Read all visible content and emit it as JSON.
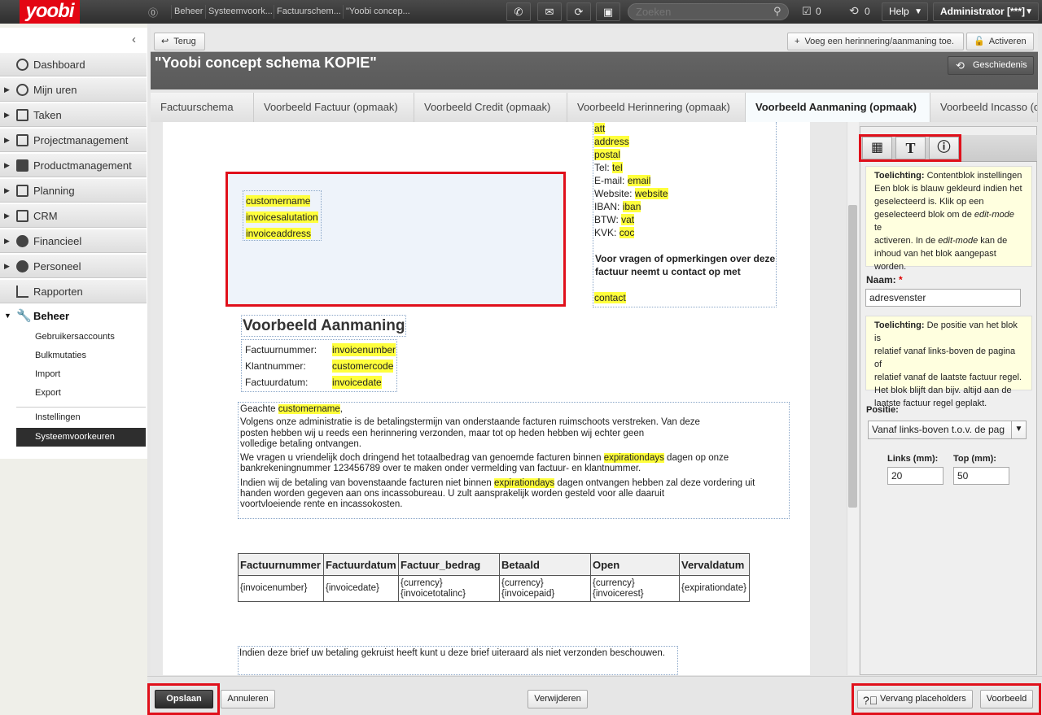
{
  "app": {
    "logo": "yoobi"
  },
  "breadcrumbs": [
    "Beheer",
    "Systeemvoork...",
    "Factuurschem...",
    "\"Yoobi concep..."
  ],
  "topbar": {
    "search_placeholder": "Zoeken",
    "tasks_count": "0",
    "sync_count": "0",
    "help_label": "Help",
    "user_label": "Administrator [***]"
  },
  "sidebar": {
    "items": [
      {
        "label": "Dashboard"
      },
      {
        "label": "Mijn uren"
      },
      {
        "label": "Taken"
      },
      {
        "label": "Projectmanagement"
      },
      {
        "label": "Productmanagement"
      },
      {
        "label": "Planning"
      },
      {
        "label": "CRM"
      },
      {
        "label": "Financieel"
      },
      {
        "label": "Personeel"
      },
      {
        "label": "Rapporten"
      },
      {
        "label": "Beheer"
      }
    ],
    "sub_items": [
      "Gebruikersaccounts",
      "Bulkmutaties",
      "Import",
      "Export",
      "Instellingen",
      "Systeemvoorkeuren"
    ]
  },
  "header": {
    "back_label": "Terug",
    "reminder_label": "Voeg een herinnering/aanmaning toe.",
    "activate_label": "Activeren",
    "title": "\"Yoobi concept schema KOPIE\"",
    "history_label": "Geschiedenis"
  },
  "tabs": [
    {
      "label": "Factuurschema"
    },
    {
      "label": "Voorbeeld Factuur (opmaak)"
    },
    {
      "label": "Voorbeeld Credit (opmaak)"
    },
    {
      "label": "Voorbeeld Herinnering (opmaak)"
    },
    {
      "label": "Voorbeeld Aanmaning (opmaak)"
    },
    {
      "label": "Voorbeeld Incasso (op"
    }
  ],
  "document": {
    "address_fields": [
      "customername",
      "invoicesalutation",
      "invoiceaddress"
    ],
    "company_info": {
      "att": "att",
      "address": "address",
      "postal": "postal",
      "tel_label": "Tel:",
      "tel": "tel",
      "email_label": "E-mail:",
      "email": "email",
      "website_label": "Website:",
      "website": "website",
      "iban_label": "IBAN:",
      "iban": "iban",
      "btw_label": "BTW:",
      "btw": "vat",
      "kvk_label": "KVK:",
      "kvk": "coc",
      "contact_text": "Voor vragen of opmerkingen over deze factuur neemt u contact op met",
      "contact": "contact"
    },
    "heading": "Voorbeeld Aanmaning",
    "meta": [
      {
        "label": "Factuurnummer:",
        "value": "invoicenumber"
      },
      {
        "label": "Klantnummer:",
        "value": "customercode"
      },
      {
        "label": "Factuurdatum:",
        "value": "invoicedate"
      }
    ],
    "greeting": "Geachte",
    "greeting_name": "customername",
    "para1_l1": "Volgens onze administratie is de betalingstermijn van onderstaande facturen ruimschoots verstreken. Van deze",
    "para1_l2": "posten hebben wij u reeds een herinnering verzonden, maar tot op heden hebben wij echter geen",
    "para1_l3": "volledige betaling ontvangen.",
    "para2_a": "We vragen u vriendelijk doch dringend het totaalbedrag van genoemde facturen binnen",
    "para2_hl": "expirationdays",
    "para2_b": "dagen op onze",
    "para2_l2": "bankrekeningnummer 123456789 over te maken onder vermelding van factuur- en klantnummer.",
    "para3_a": "Indien wij de betaling van bovenstaande facturen niet binnen",
    "para3_hl": "expirationdays",
    "para3_b": "dagen ontvangen hebben zal deze vordering uit",
    "para3_l2": "handen worden gegeven aan ons incassobureau. U zult aansprakelijk worden gesteld voor alle daaruit",
    "para3_l3": "voortvloeiende rente en incassokosten.",
    "table": {
      "headers": [
        "Factuurnummer",
        "Factuurdatum",
        "Factuur_bedrag",
        "Betaald",
        "Open",
        "Vervaldatum"
      ],
      "row": [
        [
          "{invoicenumber}"
        ],
        [
          "{invoicedate}"
        ],
        [
          "{currency}",
          "{invoicetotalinc}"
        ],
        [
          "{currency}",
          "{invoicepaid}"
        ],
        [
          "{currency}",
          "{invoicerest}"
        ],
        [
          "{expirationdate}"
        ]
      ]
    },
    "footer": "Indien deze brief uw betaling gekruist heeft kunt u deze brief uiteraard als niet verzonden beschouwen."
  },
  "panel": {
    "note1_bold": "Toelichting:",
    "note1_l1": "Contentblok instellingen",
    "note1_l2": "Een blok is blauw gekleurd indien het",
    "note1_l3": "geselecteerd is. Klik op een",
    "note1_l4a": "geselecteerd blok om de ",
    "note1_l4i": "edit-mode",
    "note1_l4b": " te",
    "note1_l5a": "activeren. In de ",
    "note1_l5i": "edit-mode",
    "note1_l5b": " kan de",
    "note1_l6": "inhoud van het blok aangepast",
    "note1_l7": "worden.",
    "name_label": "Naam:",
    "name_required": "*",
    "name_value": "adresvenster",
    "note2_bold": "Toelichting:",
    "note2_l1": "De positie van het blok is",
    "note2_l2": "relatief vanaf links-boven de pagina of",
    "note2_l3": "relatief vanaf de laatste factuur regel.",
    "note2_l4": "Het blok blijft dan bijv. altijd aan de",
    "note2_l5": "laatste factuur regel geplakt.",
    "position_label": "Positie:",
    "position_value": "Vanaf links-boven t.o.v. de pag",
    "left_label": "Links (mm):",
    "left_value": "20",
    "top_label": "Top (mm):",
    "top_value": "50"
  },
  "bottom": {
    "save_label": "Opslaan",
    "cancel_label": "Annuleren",
    "delete_label": "Verwijderen",
    "replace_label": "Vervang placeholders",
    "preview_label": "Voorbeeld"
  },
  "colors": {
    "brand": "#e30613",
    "highlight": "#ffff3c",
    "annotation_red": "#e0101b"
  }
}
